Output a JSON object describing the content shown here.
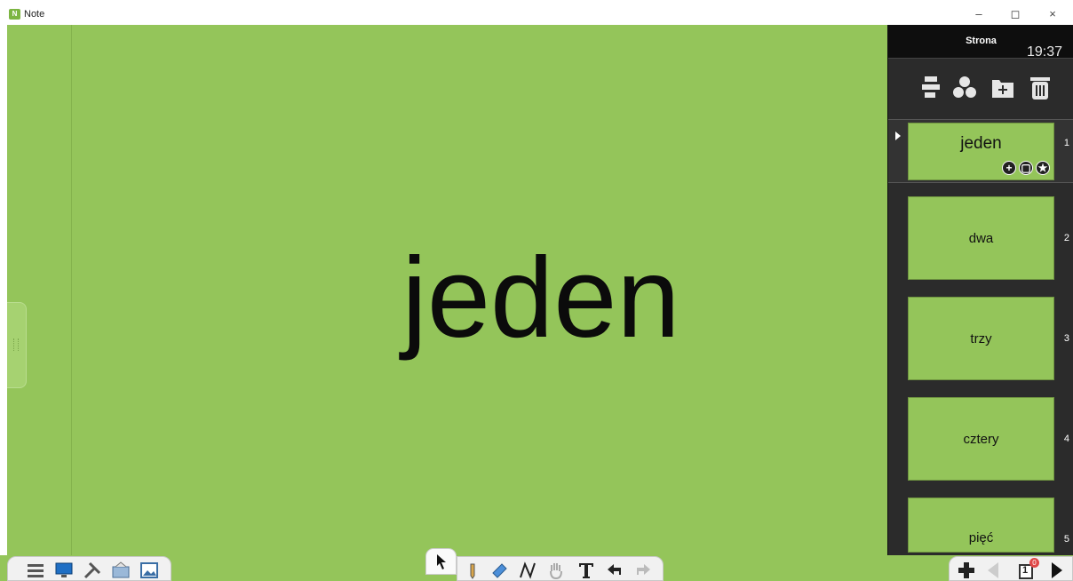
{
  "window": {
    "title": "Note",
    "buttons": {
      "minimize": "–",
      "maximize": "◻",
      "close": "×"
    }
  },
  "canvas": {
    "background": "#94c55a",
    "text": "jeden"
  },
  "panel": {
    "title": "Strona",
    "clock": "19:37",
    "tools": [
      "page-layout-icon",
      "group-icon",
      "add-folder-icon",
      "trash-icon"
    ],
    "pages": [
      {
        "label": "jeden",
        "number": "1",
        "selected": true
      },
      {
        "label": "dwa",
        "number": "2"
      },
      {
        "label": "trzy",
        "number": "3"
      },
      {
        "label": "cztery",
        "number": "4"
      },
      {
        "label": "pięć",
        "number": "5"
      }
    ],
    "thumb_actions": {
      "add": "+",
      "copy": "▢",
      "fav": "★"
    }
  },
  "bottom": {
    "left_tools": [
      "menu-icon",
      "screen-icon",
      "tools-icon",
      "gallery-icon",
      "image-icon"
    ],
    "center_tools": [
      "pointer-icon",
      "pen-icon",
      "eraser-icon",
      "curve-icon",
      "hand-icon",
      "text-icon",
      "undo-icon",
      "redo-icon"
    ],
    "right_tools": [
      "add-page-icon",
      "prev-page-icon",
      "page-count-icon",
      "next-page-icon"
    ],
    "page_indicator": "1",
    "page_badge": "0"
  }
}
